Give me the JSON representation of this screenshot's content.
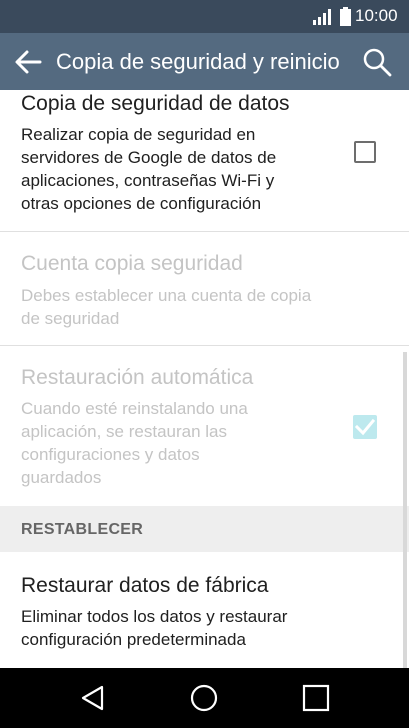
{
  "status_bar": {
    "time": "10:00",
    "icons": [
      "signal-icon",
      "battery-icon"
    ]
  },
  "app_bar": {
    "title": "Copia de seguridad y reinicio",
    "icons": [
      "back-arrow-icon",
      "search-icon"
    ]
  },
  "preferences": [
    {
      "title": "Copia de seguridad de datos",
      "summary": [
        "Realizar copia de seguridad en",
        "servidores de Google de datos de",
        "aplicaciones, contraseñas Wi-Fi y",
        "otras opciones de configuración"
      ],
      "checked": false,
      "enabled": true
    },
    {
      "title": "Cuenta copia seguridad",
      "summary": [
        "Debes establecer una cuenta de copia",
        "de seguridad"
      ],
      "enabled": false
    },
    {
      "title": "Restauración automática",
      "summary": [
        "Cuando esté reinstalando una",
        "aplicación, se restauran las",
        "configuraciones y datos",
        "guardados"
      ],
      "checked": true,
      "enabled": false
    }
  ],
  "section": {
    "label": "RESTABLECER"
  },
  "reset": {
    "title": "Restaurar datos de fábrica",
    "summary": [
      "Eliminar todos los datos y restaurar",
      "configuración predeterminada"
    ]
  },
  "nav_bar": {
    "icons": [
      "nav-back-icon",
      "nav-home-icon",
      "nav-recents-icon"
    ]
  },
  "colors": {
    "status_bar": "#3a4a5c",
    "app_bar": "#546a80",
    "disabled_text": "#c4c4c4",
    "checkbox_checked_disabled": "#bde9ee"
  }
}
